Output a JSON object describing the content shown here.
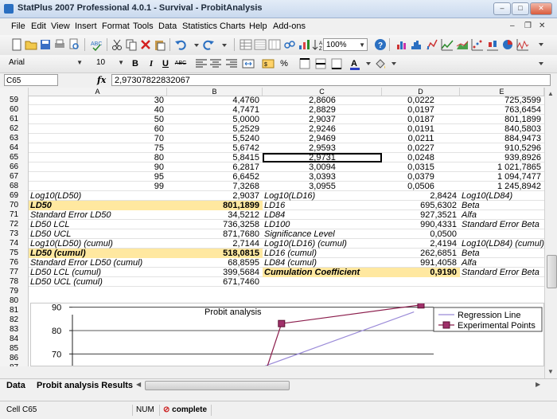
{
  "window": {
    "title": "StatPlus 2007 Professional 4.0.1 - Survival - ProbitAnalysis"
  },
  "menu": [
    "File",
    "Edit",
    "View",
    "Insert",
    "Format",
    "Tools",
    "Data",
    "Statistics",
    "Charts",
    "Help",
    "Add-ons"
  ],
  "toolbar": {
    "zoom": "100%",
    "font": "Arial",
    "size": "10",
    "bold": "B",
    "italic": "I",
    "underline": "U",
    "strike": "ABC",
    "percent": "%"
  },
  "formula_bar": {
    "cell_ref": "C65",
    "fx": "fx",
    "value": "2,97307822832067"
  },
  "columns": [
    "A",
    "B",
    "C",
    "D",
    "E"
  ],
  "rows": [
    {
      "n": "59",
      "a": "30",
      "b": "4,4760",
      "c": "2,8606",
      "d": "0,0222",
      "e": "725,3599"
    },
    {
      "n": "60",
      "a": "40",
      "b": "4,7471",
      "c": "2,8829",
      "d": "0,0197",
      "e": "763,6454"
    },
    {
      "n": "61",
      "a": "50",
      "b": "5,0000",
      "c": "2,9037",
      "d": "0,0187",
      "e": "801,1899"
    },
    {
      "n": "62",
      "a": "60",
      "b": "5,2529",
      "c": "2,9246",
      "d": "0,0191",
      "e": "840,5803"
    },
    {
      "n": "63",
      "a": "70",
      "b": "5,5240",
      "c": "2,9469",
      "d": "0,0211",
      "e": "884,9473"
    },
    {
      "n": "64",
      "a": "75",
      "b": "5,6742",
      "c": "2,9593",
      "d": "0,0227",
      "e": "910,5296"
    },
    {
      "n": "65",
      "a": "80",
      "b": "5,8415",
      "c": "2,9731",
      "d": "0,0248",
      "e": "939,8926"
    },
    {
      "n": "66",
      "a": "90",
      "b": "6,2817",
      "c": "3,0094",
      "d": "0,0315",
      "e": "1 021,7865"
    },
    {
      "n": "67",
      "a": "95",
      "b": "6,6452",
      "c": "3,0393",
      "d": "0,0379",
      "e": "1 094,7477"
    },
    {
      "n": "68",
      "a": "99",
      "b": "7,3268",
      "c": "3,0955",
      "d": "0,0506",
      "e": "1 245,8942"
    }
  ],
  "results": [
    {
      "n": "69",
      "a": "Log10(LD50)",
      "b": "2,9037",
      "c": "Log10(LD16)",
      "d": "2,8424",
      "e": "Log10(LD84)"
    },
    {
      "n": "70",
      "a": "LD50",
      "b": "801,1899",
      "c": "LD16",
      "d": "695,6302",
      "e": "Beta"
    },
    {
      "n": "71",
      "a": "Standard Error LD50",
      "b": "34,5212",
      "c": "LD84",
      "d": "927,3521",
      "e": "Alfa"
    },
    {
      "n": "72",
      "a": "LD50 LCL",
      "b": "736,3258",
      "c": "LD100",
      "d": "990,4331",
      "e": "Standard Error Beta"
    },
    {
      "n": "73",
      "a": "LD50 UCL",
      "b": "871,7680",
      "c": "Significance Level",
      "d": "0,0500",
      "e": ""
    },
    {
      "n": "74",
      "a": "Log10(LD50) (cumul)",
      "b": "2,7144",
      "c": "Log10(LD16) (cumul)",
      "d": "2,4194",
      "e": "Log10(LD84) (cumul)"
    },
    {
      "n": "75",
      "a": "LD50 (cumul)",
      "b": "518,0815",
      "c": "LD16 (cumul)",
      "d": "262,6851",
      "e": "Beta"
    },
    {
      "n": "76",
      "a": "Standard Error LD50 (cumul)",
      "b": "68,8595",
      "c": "LD84 (cumul)",
      "d": "991,4058",
      "e": "Alfa"
    },
    {
      "n": "77",
      "a": "LD50 LCL (cumul)",
      "b": "399,5684",
      "c": "Cumulation Coefficient",
      "d": "0,9190",
      "e": "Standard Error Beta"
    },
    {
      "n": "78",
      "a": "LD50 UCL (cumul)",
      "b": "671,7460",
      "c": "",
      "d": "",
      "e": ""
    }
  ],
  "empty_rows": [
    "79",
    "80",
    "81",
    "82",
    "83",
    "84",
    "85",
    "86",
    "87"
  ],
  "chart_data": {
    "type": "line",
    "title": "Probit analysis",
    "ylim": [
      65,
      95
    ],
    "yticks": [
      70,
      80,
      90
    ],
    "legend": [
      "Regression Line",
      "Experimental Points"
    ],
    "legend_placement": "top-right",
    "colors": {
      "regression": "#9a8ad8",
      "points": "#8b1d4c",
      "marker_fill": "#a0306a"
    },
    "regression_line": [
      [
        0.0,
        62
      ],
      [
        1.0,
        88
      ]
    ],
    "experimental_points": [
      [
        0.6,
        83
      ],
      [
        1.0,
        91
      ]
    ]
  },
  "sheets": [
    "Data",
    "Probit analysis Results"
  ],
  "status": {
    "cell": "Cell C65",
    "num": "NUM",
    "brand": "complete"
  }
}
